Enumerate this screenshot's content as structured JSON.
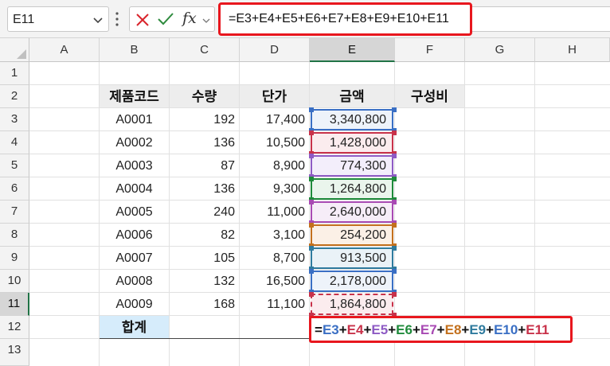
{
  "name_box": "E11",
  "formula_bar": {
    "fx_label": "fx",
    "formula": "=E3+E4+E5+E6+E7+E8+E9+E10+E11"
  },
  "columns": [
    "A",
    "B",
    "C",
    "D",
    "E",
    "F",
    "G",
    "H"
  ],
  "rows": [
    "1",
    "2",
    "3",
    "4",
    "5",
    "6",
    "7",
    "8",
    "9",
    "10",
    "11",
    "12",
    "13"
  ],
  "headers": {
    "code": "제품코드",
    "qty": "수량",
    "price": "단가",
    "amount": "금액",
    "ratio": "구성비"
  },
  "data_rows": [
    {
      "code": "A0001",
      "qty": "192",
      "price": "17,400",
      "amount": "3,340,800"
    },
    {
      "code": "A0002",
      "qty": "136",
      "price": "10,500",
      "amount": "1,428,000"
    },
    {
      "code": "A0003",
      "qty": "87",
      "price": "8,900",
      "amount": "774,300"
    },
    {
      "code": "A0004",
      "qty": "136",
      "price": "9,300",
      "amount": "1,264,800"
    },
    {
      "code": "A0005",
      "qty": "240",
      "price": "11,000",
      "amount": "2,640,000"
    },
    {
      "code": "A0006",
      "qty": "82",
      "price": "3,100",
      "amount": "254,200"
    },
    {
      "code": "A0007",
      "qty": "105",
      "price": "8,700",
      "amount": "913,500"
    },
    {
      "code": "A0008",
      "qty": "132",
      "price": "16,500",
      "amount": "2,178,000"
    },
    {
      "code": "A0009",
      "qty": "168",
      "price": "11,100",
      "amount": "1,864,800"
    }
  ],
  "total_label": "합계",
  "edit_formula": {
    "eq": "=",
    "plus": "+",
    "refs": [
      {
        "text": "E3",
        "color": "#3a6fc4"
      },
      {
        "text": "E4",
        "color": "#c8324a"
      },
      {
        "text": "E5",
        "color": "#8e5bc4"
      },
      {
        "text": "E6",
        "color": "#1f8a3b"
      },
      {
        "text": "E7",
        "color": "#a84ab3"
      },
      {
        "text": "E8",
        "color": "#c3701d"
      },
      {
        "text": "E9",
        "color": "#2f7b9e"
      },
      {
        "text": "E10",
        "color": "#3a6fc4"
      },
      {
        "text": "E11",
        "color": "#c8324a"
      }
    ]
  },
  "ref_fills": [
    "#eef3fa",
    "#fbecee",
    "#f3eefb",
    "#eaf5ec",
    "#f6edf8",
    "#fbf0e6",
    "#eaf2f7",
    "#eef3fa",
    "#fbecee"
  ]
}
